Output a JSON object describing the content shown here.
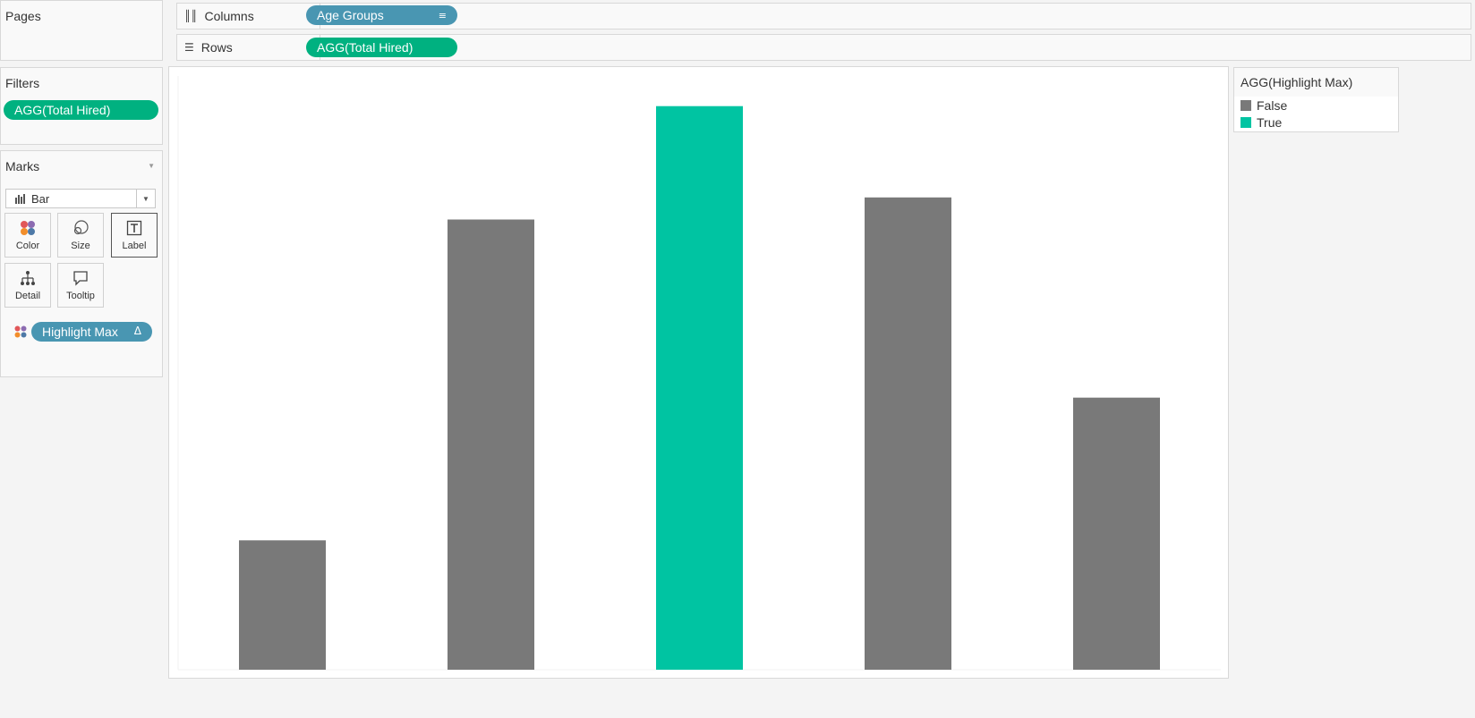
{
  "pages": {
    "title": "Pages"
  },
  "shelves": {
    "columns": {
      "label": "Columns",
      "icon": "columns-icon",
      "pill": "Age Groups"
    },
    "rows": {
      "label": "Rows",
      "icon": "rows-icon",
      "pill": "AGG(Total Hired)"
    }
  },
  "filters": {
    "title": "Filters",
    "pill": "AGG(Total Hired)"
  },
  "marks": {
    "title": "Marks",
    "type": "Bar",
    "buttons": [
      {
        "label": "Color",
        "icon": "color-icon"
      },
      {
        "label": "Size",
        "icon": "size-icon"
      },
      {
        "label": "Label",
        "icon": "label-icon"
      },
      {
        "label": "Detail",
        "icon": "detail-icon"
      },
      {
        "label": "Tooltip",
        "icon": "tooltip-icon"
      }
    ],
    "color_field": "Highlight Max"
  },
  "legend": {
    "title": "AGG(Highlight Max)",
    "items": [
      {
        "label": "False",
        "color": "#797979"
      },
      {
        "label": "True",
        "color": "#00c4a2"
      }
    ]
  },
  "colors": {
    "blue_pill": "#4996b2",
    "green_pill": "#00b180",
    "bar_default": "#797979",
    "bar_highlight": "#00c4a2"
  },
  "chart_data": {
    "type": "bar",
    "categories": [
      "",
      "",
      "",
      "",
      ""
    ],
    "values": [
      146,
      508,
      636,
      533,
      307
    ],
    "highlight": [
      false,
      false,
      true,
      false,
      false
    ],
    "ylim": [
      0,
      670
    ],
    "grid": false,
    "xlabel": "",
    "ylabel": ""
  }
}
